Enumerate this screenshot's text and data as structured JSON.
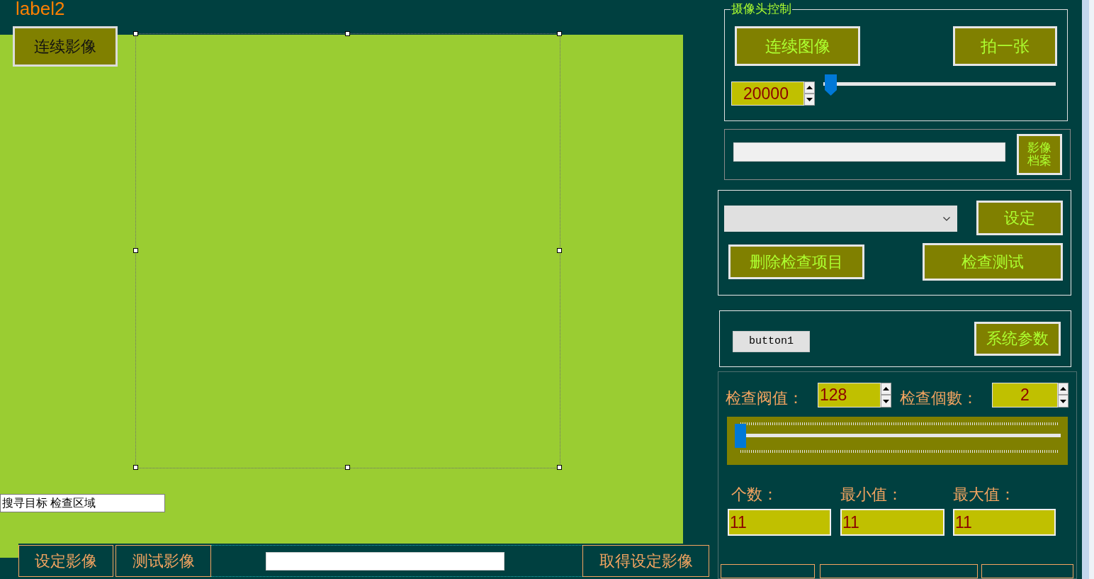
{
  "form_label": "label2",
  "canvas": {
    "button": "连续影像",
    "picture_box": {
      "selected": true
    },
    "text_field": {
      "value": "搜寻目标 检查区域"
    }
  },
  "bottom_bar": {
    "buttons": [
      "设定影像",
      "测试影像"
    ],
    "right_button": "取得设定影像"
  },
  "camera_control": {
    "title": "摄像头控制",
    "buttons": [
      "连续图像",
      "拍一张"
    ],
    "interval": {
      "value": "20000"
    },
    "slider": {
      "level": 0
    }
  },
  "image_file": {
    "button": "影像档案"
  },
  "inspection_items": {
    "set_button": "设定",
    "delete_button": "删除检查项目",
    "test_button": "检查测试"
  },
  "system": {
    "button1": "button1",
    "params_button": "系统参数"
  },
  "inspection": {
    "threshold_label": "检查阀值：",
    "threshold": "128",
    "count_label": "检查個數：",
    "count": "2",
    "slider": {
      "level": 0
    },
    "stats": [
      {
        "label": "个数：",
        "value": "11"
      },
      {
        "label": "最小值：",
        "value": "11"
      },
      {
        "label": "最大值：",
        "value": "11"
      }
    ]
  }
}
